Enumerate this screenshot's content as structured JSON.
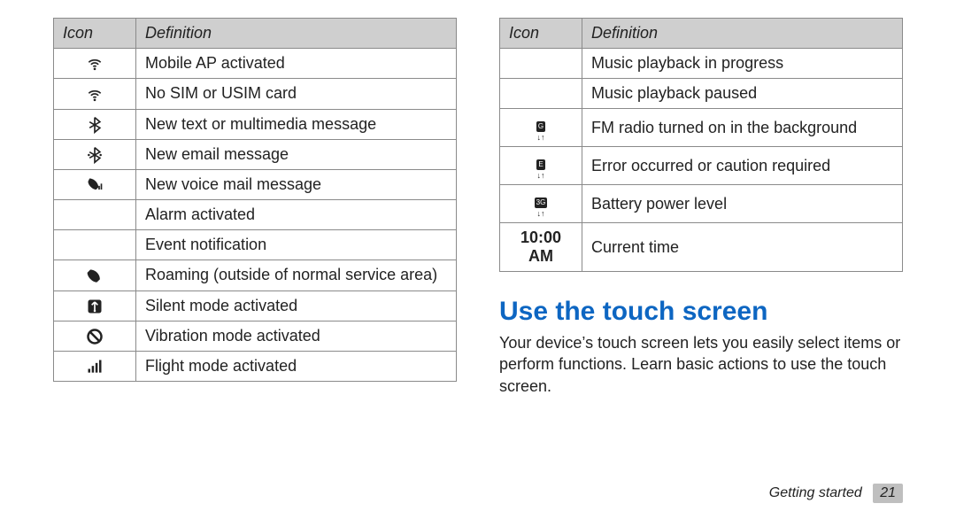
{
  "left_table": {
    "header": {
      "icon": "Icon",
      "definition": "Definition"
    },
    "rows": [
      {
        "icon": "wifi-dot-icon",
        "text": "Mobile AP activated"
      },
      {
        "icon": "wifi-dot-icon",
        "text": "No SIM or USIM card"
      },
      {
        "icon": "bluetooth-icon",
        "text": "New text or multimedia message"
      },
      {
        "icon": "bluetooth-active-icon",
        "text": "New email message"
      },
      {
        "icon": "handset-bars-icon",
        "text": "New voice mail message"
      },
      {
        "icon": "",
        "text": "Alarm activated"
      },
      {
        "icon": "",
        "text": "Event notification"
      },
      {
        "icon": "handset-icon",
        "text": "Roaming (outside of normal service area)"
      },
      {
        "icon": "usb-badge-icon",
        "text": "Silent mode activated"
      },
      {
        "icon": "prohibit-icon",
        "text": "Vibration mode activated"
      },
      {
        "icon": "signal-bars-icon",
        "text": "Flight mode activated"
      }
    ]
  },
  "right_table": {
    "header": {
      "icon": "Icon",
      "definition": "Definition"
    },
    "rows": [
      {
        "icon": "",
        "text": "Music playback in progress"
      },
      {
        "icon": "",
        "text": "Music playback paused"
      },
      {
        "icon": "g-data-icon",
        "badge": "G",
        "text": "FM radio turned on in the background"
      },
      {
        "icon": "e-data-icon",
        "badge": "E",
        "text": "Error occurred or caution required"
      },
      {
        "icon": "3g-data-icon",
        "badge": "3G",
        "text": "Battery power level"
      },
      {
        "icon": "time-icon",
        "time_text": "10:00 AM",
        "text": "Current time"
      }
    ]
  },
  "section": {
    "title": "Use the touch screen",
    "body": "Your device’s touch screen lets you easily select items or perform functions. Learn basic actions to use the touch screen."
  },
  "footer": {
    "section_name": "Getting started",
    "page_number": "21"
  }
}
